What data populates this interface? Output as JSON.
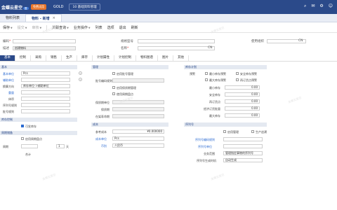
{
  "topbar": {
    "logo": "金蝶云星空",
    "logo_tag": "云",
    "trial": "免费试用",
    "edition": "GOLD",
    "org": "10 基础资料管理"
  },
  "tabs": [
    {
      "label": "物料列表"
    },
    {
      "label": "物料 - 新增"
    }
  ],
  "toolbar": {
    "items": [
      "保存",
      "提交",
      "审核",
      "关联查询",
      "业务操作",
      "列表",
      "选项",
      "退出",
      "刷新"
    ]
  },
  "header": {
    "code_label": "编码",
    "name_label": "名称",
    "spec_label": "规格型号",
    "desc_label": "描述",
    "desc_value": "创建物料",
    "use_org_label": "使用组织",
    "create_org_label": "创建组织",
    "cn": "CN"
  },
  "subtabs": [
    "基本",
    "控制",
    "采购",
    "销售",
    "生产",
    "库存",
    "计划属性",
    "计划控制",
    "物料图谱",
    "图片",
    "其他"
  ],
  "basic": {
    "section": "基本",
    "base_unit_label": "基本单位",
    "base_unit_value": "Pcs",
    "aux_unit_label": "辅助单位",
    "conv_label": "换算方向",
    "conv_value": "库存单位->辅助单位",
    "weight_label": "重量",
    "vol_label": "体积",
    "serial_label": "序列号规则",
    "batch_label": "批号规则",
    "stock_section": "库存控制",
    "stock_check": "可发库存",
    "period_section": "周期储备",
    "period_label": "启用周期盘点",
    "cycle_label": "周期",
    "cycle_value": "1",
    "unit_label": "天",
    "sum_label": "合计"
  },
  "manage": {
    "section": "管理",
    "checks": [
      "启用批号管理",
      "启用保质期管理",
      "使用周期盘点"
    ],
    "batch_rule_label": "批号编码规则",
    "shelf_unit_label": "保质期单位",
    "shelf_label": "保质期",
    "advance_label": "在架寿命期",
    "cost_section": "成本",
    "ref_cost_label": "参考成本",
    "ref_cost_value": "¥0.000000",
    "cost_unit_label": "成本单位",
    "cost_unit_value": "Pcs",
    "currency_label": "币别",
    "currency_value": "人民币"
  },
  "plan": {
    "section": "库存计划",
    "warn_label": "预警",
    "checks": [
      "最小库存预警",
      "安全库存预警",
      "最大库存预警",
      "再订货点预警"
    ],
    "min_label": "最小库存",
    "safe_label": "安全库存",
    "reorder_label": "再订货点",
    "econ_label": "经济订货批量",
    "max_label": "最大库存",
    "zero": "0.00",
    "serial_section": "序列号",
    "serial_checks": [
      "启用管理",
      "生产追溯"
    ],
    "sn_rule_label": "序列号编码规则",
    "sn_unit_label": "序列号单位",
    "sn_scope_label": "业务范围",
    "sn_scope_value": "管理指定事物的序列号",
    "sn_gen_label": "序列号生成时机",
    "sn_gen_value": "自动生成"
  },
  "watermark": "金蝶云星空"
}
